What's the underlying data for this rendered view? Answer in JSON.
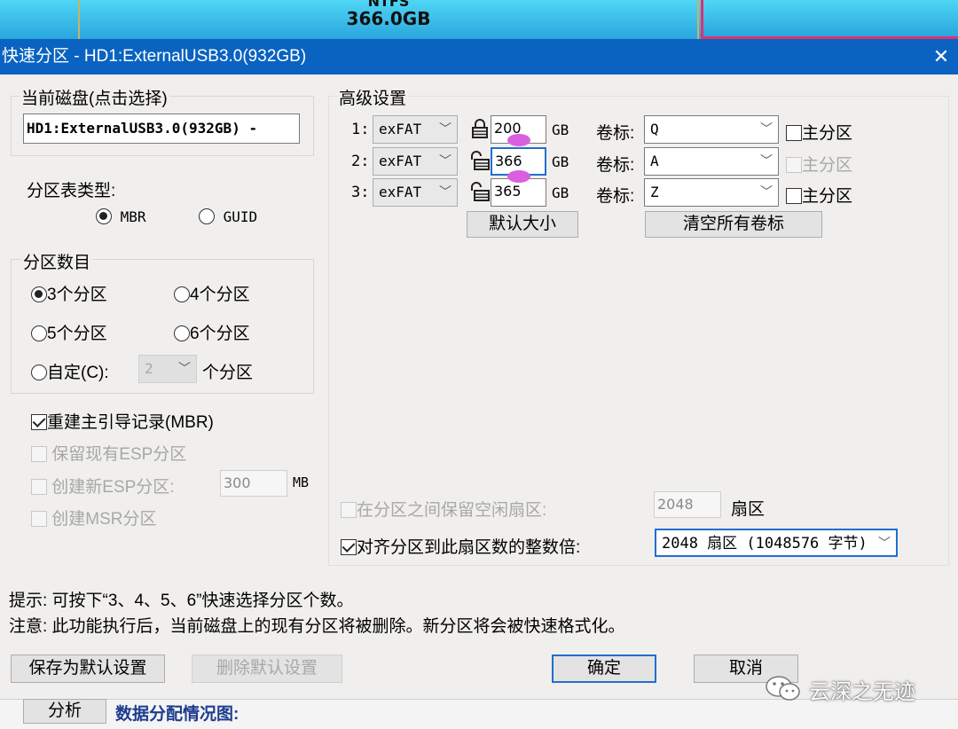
{
  "disk_map": {
    "fs": "NTFS",
    "size": "366.0GB"
  },
  "title": "快速分区 - HD1:ExternalUSB3.0(932GB)",
  "close_symbol": "✕",
  "current_disk": {
    "legend": "当前磁盘(点击选择)",
    "value": "HD1:ExternalUSB3.0(932GB) -"
  },
  "table_type": {
    "label": "分区表类型:",
    "options": [
      "MBR",
      "GUID"
    ]
  },
  "partition_count": {
    "legend": "分区数目",
    "opt3": "3个分区",
    "opt4": "4个分区",
    "opt5": "5个分区",
    "opt6": "6个分区",
    "custom": "自定(C):",
    "custom_value": "2",
    "custom_suffix": "个分区"
  },
  "options": {
    "rebuild_mbr": "重建主引导记录(MBR)",
    "keep_esp": "保留现有ESP分区",
    "new_esp": "创建新ESP分区:",
    "esp_size": "300",
    "esp_unit": "MB",
    "msr": "创建MSR分区"
  },
  "advanced": {
    "legend": "高级设置",
    "rows": [
      {
        "index": "1:",
        "fs": "exFAT",
        "size": "200",
        "unit": "GB",
        "vol_label": "卷标:",
        "vol": "Q",
        "primary": "主分区"
      },
      {
        "index": "2:",
        "fs": "exFAT",
        "size": "366",
        "unit": "GB",
        "vol_label": "卷标:",
        "vol": "A",
        "primary": "主分区"
      },
      {
        "index": "3:",
        "fs": "exFAT",
        "size": "365",
        "unit": "GB",
        "vol_label": "卷标:",
        "vol": "Z",
        "primary": "主分区"
      }
    ],
    "default_size_btn": "默认大小",
    "clear_labels_btn": "清空所有卷标",
    "reserve_free": "在分区之间保留空闲扇区:",
    "reserve_value": "2048",
    "reserve_unit": "扇区",
    "align": "对齐分区到此扇区数的整数倍:",
    "align_value": "2048 扇区 (1048576 字节)"
  },
  "tips": {
    "hint": "提示: 可按下“3、4、5、6”快速选择分区个数。",
    "note": "注意: 此功能执行后，当前磁盘上的现有分区将被删除。新分区将会被快速格式化。"
  },
  "buttons": {
    "save_default": "保存为默认设置",
    "delete_default": "删除默认设置",
    "ok": "确定",
    "cancel": "取消"
  },
  "under": {
    "analyze": "分析",
    "chart_label": "数据分配情况图:"
  },
  "watermark": "云深之无迹"
}
